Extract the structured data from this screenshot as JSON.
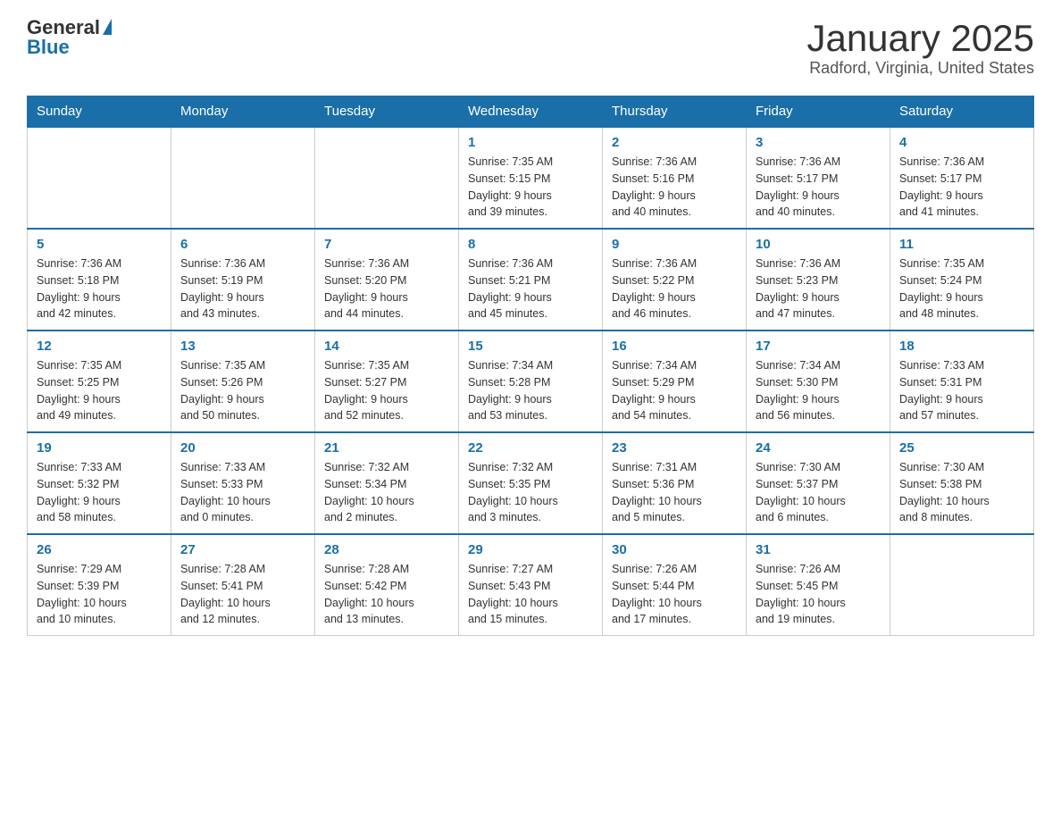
{
  "header": {
    "logo_line1": "General",
    "logo_line2": "Blue",
    "title": "January 2025",
    "subtitle": "Radford, Virginia, United States"
  },
  "calendar": {
    "days_of_week": [
      "Sunday",
      "Monday",
      "Tuesday",
      "Wednesday",
      "Thursday",
      "Friday",
      "Saturday"
    ],
    "weeks": [
      [
        {
          "day": "",
          "info": ""
        },
        {
          "day": "",
          "info": ""
        },
        {
          "day": "",
          "info": ""
        },
        {
          "day": "1",
          "info": "Sunrise: 7:35 AM\nSunset: 5:15 PM\nDaylight: 9 hours\nand 39 minutes."
        },
        {
          "day": "2",
          "info": "Sunrise: 7:36 AM\nSunset: 5:16 PM\nDaylight: 9 hours\nand 40 minutes."
        },
        {
          "day": "3",
          "info": "Sunrise: 7:36 AM\nSunset: 5:17 PM\nDaylight: 9 hours\nand 40 minutes."
        },
        {
          "day": "4",
          "info": "Sunrise: 7:36 AM\nSunset: 5:17 PM\nDaylight: 9 hours\nand 41 minutes."
        }
      ],
      [
        {
          "day": "5",
          "info": "Sunrise: 7:36 AM\nSunset: 5:18 PM\nDaylight: 9 hours\nand 42 minutes."
        },
        {
          "day": "6",
          "info": "Sunrise: 7:36 AM\nSunset: 5:19 PM\nDaylight: 9 hours\nand 43 minutes."
        },
        {
          "day": "7",
          "info": "Sunrise: 7:36 AM\nSunset: 5:20 PM\nDaylight: 9 hours\nand 44 minutes."
        },
        {
          "day": "8",
          "info": "Sunrise: 7:36 AM\nSunset: 5:21 PM\nDaylight: 9 hours\nand 45 minutes."
        },
        {
          "day": "9",
          "info": "Sunrise: 7:36 AM\nSunset: 5:22 PM\nDaylight: 9 hours\nand 46 minutes."
        },
        {
          "day": "10",
          "info": "Sunrise: 7:36 AM\nSunset: 5:23 PM\nDaylight: 9 hours\nand 47 minutes."
        },
        {
          "day": "11",
          "info": "Sunrise: 7:35 AM\nSunset: 5:24 PM\nDaylight: 9 hours\nand 48 minutes."
        }
      ],
      [
        {
          "day": "12",
          "info": "Sunrise: 7:35 AM\nSunset: 5:25 PM\nDaylight: 9 hours\nand 49 minutes."
        },
        {
          "day": "13",
          "info": "Sunrise: 7:35 AM\nSunset: 5:26 PM\nDaylight: 9 hours\nand 50 minutes."
        },
        {
          "day": "14",
          "info": "Sunrise: 7:35 AM\nSunset: 5:27 PM\nDaylight: 9 hours\nand 52 minutes."
        },
        {
          "day": "15",
          "info": "Sunrise: 7:34 AM\nSunset: 5:28 PM\nDaylight: 9 hours\nand 53 minutes."
        },
        {
          "day": "16",
          "info": "Sunrise: 7:34 AM\nSunset: 5:29 PM\nDaylight: 9 hours\nand 54 minutes."
        },
        {
          "day": "17",
          "info": "Sunrise: 7:34 AM\nSunset: 5:30 PM\nDaylight: 9 hours\nand 56 minutes."
        },
        {
          "day": "18",
          "info": "Sunrise: 7:33 AM\nSunset: 5:31 PM\nDaylight: 9 hours\nand 57 minutes."
        }
      ],
      [
        {
          "day": "19",
          "info": "Sunrise: 7:33 AM\nSunset: 5:32 PM\nDaylight: 9 hours\nand 58 minutes."
        },
        {
          "day": "20",
          "info": "Sunrise: 7:33 AM\nSunset: 5:33 PM\nDaylight: 10 hours\nand 0 minutes."
        },
        {
          "day": "21",
          "info": "Sunrise: 7:32 AM\nSunset: 5:34 PM\nDaylight: 10 hours\nand 2 minutes."
        },
        {
          "day": "22",
          "info": "Sunrise: 7:32 AM\nSunset: 5:35 PM\nDaylight: 10 hours\nand 3 minutes."
        },
        {
          "day": "23",
          "info": "Sunrise: 7:31 AM\nSunset: 5:36 PM\nDaylight: 10 hours\nand 5 minutes."
        },
        {
          "day": "24",
          "info": "Sunrise: 7:30 AM\nSunset: 5:37 PM\nDaylight: 10 hours\nand 6 minutes."
        },
        {
          "day": "25",
          "info": "Sunrise: 7:30 AM\nSunset: 5:38 PM\nDaylight: 10 hours\nand 8 minutes."
        }
      ],
      [
        {
          "day": "26",
          "info": "Sunrise: 7:29 AM\nSunset: 5:39 PM\nDaylight: 10 hours\nand 10 minutes."
        },
        {
          "day": "27",
          "info": "Sunrise: 7:28 AM\nSunset: 5:41 PM\nDaylight: 10 hours\nand 12 minutes."
        },
        {
          "day": "28",
          "info": "Sunrise: 7:28 AM\nSunset: 5:42 PM\nDaylight: 10 hours\nand 13 minutes."
        },
        {
          "day": "29",
          "info": "Sunrise: 7:27 AM\nSunset: 5:43 PM\nDaylight: 10 hours\nand 15 minutes."
        },
        {
          "day": "30",
          "info": "Sunrise: 7:26 AM\nSunset: 5:44 PM\nDaylight: 10 hours\nand 17 minutes."
        },
        {
          "day": "31",
          "info": "Sunrise: 7:26 AM\nSunset: 5:45 PM\nDaylight: 10 hours\nand 19 minutes."
        },
        {
          "day": "",
          "info": ""
        }
      ]
    ]
  }
}
